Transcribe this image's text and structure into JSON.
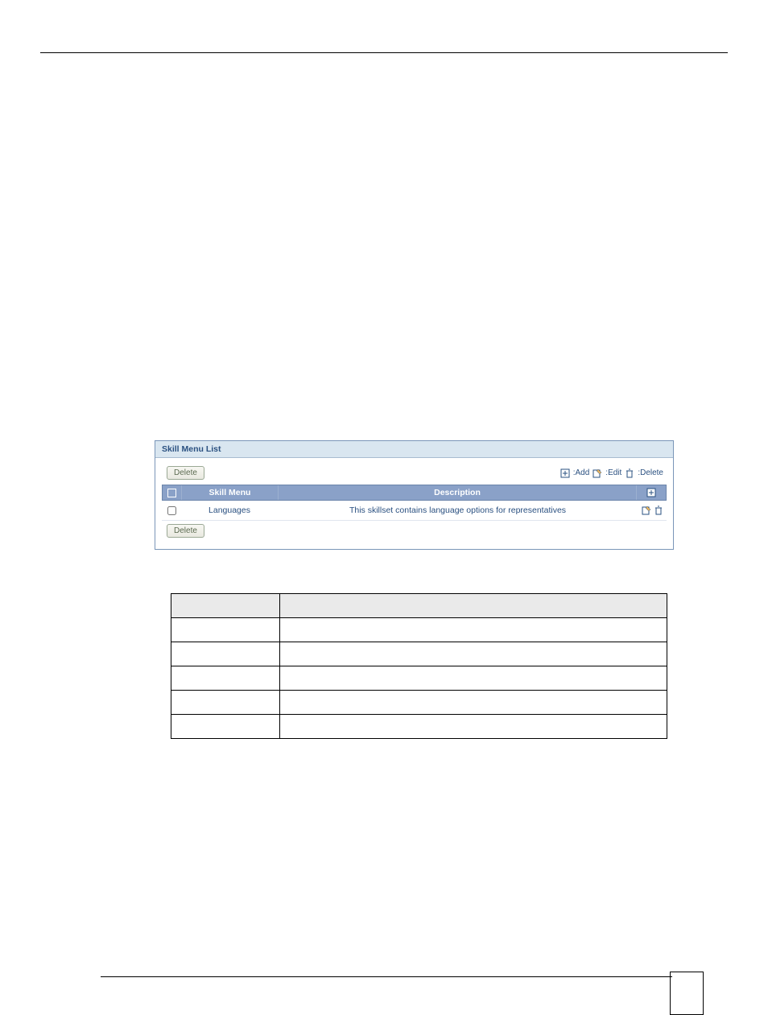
{
  "panel": {
    "title": "Skill Menu List",
    "deleteLabel": "Delete",
    "legend": {
      "add": ":Add",
      "edit": ":Edit",
      "delete": ":Delete"
    },
    "header": {
      "skill": "Skill Menu",
      "desc": "Description"
    },
    "row": {
      "skill": "Languages",
      "desc": "This skillset contains language options for representatives"
    }
  },
  "icons": {
    "add": "add-icon",
    "edit": "edit-icon",
    "delete": "delete-icon"
  }
}
